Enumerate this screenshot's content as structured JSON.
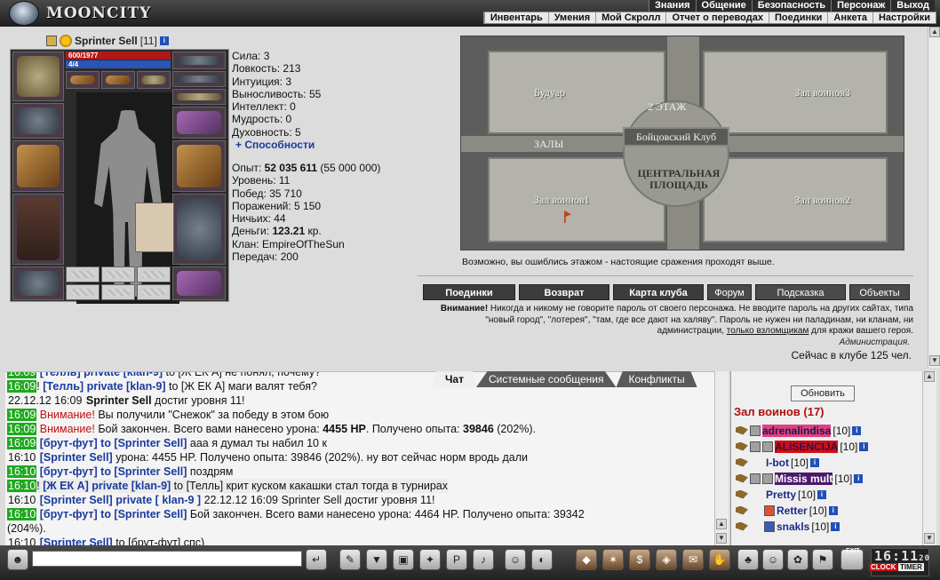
{
  "header": {
    "logo_text": "MOONCITY",
    "top_nav": [
      "Знания",
      "Общение",
      "Безопасность",
      "Персонаж",
      "Выход"
    ],
    "sub_nav": [
      "Инвентарь",
      "Умения",
      "Мой Скролл",
      "Отчет о переводах",
      "Поединки",
      "Анкета",
      "Настройки"
    ]
  },
  "character": {
    "name": "Sprinter Sell",
    "level_badge": "[11]",
    "hp": "600/1977",
    "mp": "4/4",
    "stats": {
      "strength": "Сила: 3",
      "agility": "Ловкость: 213",
      "intuition": "Интуиция: 3",
      "endurance": "Выносливость: 55",
      "intellect": "Интеллект: 0",
      "wisdom": "Мудрость: 0",
      "spirit": "Духовность: 5",
      "abilities_link": "+ Способности"
    },
    "exp_label": "Опыт: ",
    "exp_value": "52 035 611",
    "exp_next": " (55 000 000)",
    "level": "Уровень: 11",
    "wins": "Побед: 35 710",
    "losses": "Поражений: 5 150",
    "draws": "Ничьих: 44",
    "money_label": "Деньги: ",
    "money_value": "123.21",
    "money_unit": " кр.",
    "clan": "Клан: EmpireOfTheSun",
    "transfers": "Передач: 200"
  },
  "map": {
    "room_boudoir": "Будуар",
    "room_warriors3": "Зал воинов3",
    "room_warriors1": "Зал воинов1",
    "room_warriors2": "Зал воинов2",
    "floor_label": "2 ЭТАЖ",
    "club_label": "Бойцовский Клуб",
    "halls_label": "ЗАЛЫ",
    "square_label": "ЦЕНТРАЛЬНАЯ ПЛОЩАДЬ",
    "message": "Возможно, вы ошиблись этажом - настоящие сражения проходят выше."
  },
  "buttons": {
    "duels": "Поединки",
    "return": "Возврат",
    "club_map": "Карта клуба",
    "forum": "Форум",
    "hint": "Подсказка",
    "objects": "Объекты"
  },
  "warning": {
    "bold": "Внимание!",
    "text1": " Никогда и никому не говорите пароль от своего персонажа. Не вводите пароль на других сайтах, типа \"новый город\", \"лотерея\", \"там, где все дают на халяву\". Пароль не нужен ни паладинам, ни кланам, ни администрации, ",
    "underlined": "только взломщикам",
    "text2": " для кражи вашего героя.",
    "signature": "Администрация.",
    "online": "Сейчас в клубе 125 чел."
  },
  "chat_tabs": [
    "Чат",
    "Системные сообщения",
    "Конфликты"
  ],
  "chat": {
    "l0_ts": "16:09",
    "l0_a": "[Телль]",
    "l0_b": "private [klan-9]",
    "l0_c": " to [Ж ЕК А] не понял, почему?",
    "l1_ts": "16:09",
    "l1_a": "[Телль]",
    "l1_b": "private [klan-9]",
    "l1_c": " to [Ж ЕК А] маги валят тебя?",
    "l2_ts": "22.12.12 16:09",
    "l2_a": "Sprinter Sell",
    "l2_c": " достиг уровня 11!",
    "l3_ts": "16:09",
    "l3_a": "Внимание!",
    "l3_c": " Вы получили \"Снежок\" за победу в этом бою",
    "l4_ts": "16:09",
    "l4_a": "Внимание!",
    "l4_c1": " Бой закончен. Всего вами нанесено урона: ",
    "l4_hp": "4455 HP",
    "l4_c2": ". Получено опыта: ",
    "l4_exp": "39846",
    "l4_c3": " (202%).",
    "l5_ts": "16:09",
    "l5_a": "[брут-фут]",
    "l5_b": "to [Sprinter Sell]",
    "l5_c": " ааа я думал ты набил 10 к",
    "l6_ts": "16:10",
    "l6_a": "[Sprinter Sell]",
    "l6_c": " урона: 4455 HP. Получено опыта: 39846 (202%). ну вот сейчас норм вродь дали",
    "l7_ts": "16:10",
    "l7_a": "[брут-фут]",
    "l7_b": "to [Sprinter Sell]",
    "l7_c": " поздрям",
    "l8_ts": "16:10",
    "l8_a": "[Ж ЕК А]",
    "l8_b": "private [klan-9]",
    "l8_c": " to [Телль] крит куском какашки стал тогда в турнирах",
    "l9_ts": "16:10",
    "l9_a": "[Sprinter Sell]",
    "l9_b": "private [ klan-9 ]",
    "l9_c": " 22.12.12 16:09 Sprinter Sell достиг уровня 11!",
    "l10_ts": "16:10",
    "l10_a": "[брут-фут]",
    "l10_b": "to [Sprinter Sell]",
    "l10_c": " Бой закончен. Всего вами нанесено урона: 4464 HP. Получено опыта: 39342",
    "l10_cont": "(204%).",
    "l11_ts": "16:10",
    "l11_a": "[Sprinter Sell]",
    "l11_c": " to [брут-фут] спс)"
  },
  "room_panel": {
    "refresh": "Обновить",
    "title": "Зал воинов (17)",
    "players": [
      {
        "name": "adrenalindisa",
        "level": "[10]"
      },
      {
        "name": "ALISENCIJA",
        "level": "[10]"
      },
      {
        "name": "I-bot",
        "level": "[10]"
      },
      {
        "name": "Missis mult",
        "level": "[10]"
      },
      {
        "name": "Pretty",
        "level": "[10]"
      },
      {
        "name": "Retter",
        "level": "[10]"
      },
      {
        "name": "snakls",
        "level": "[10]"
      }
    ]
  },
  "clock": {
    "time": "16:11",
    "seconds": "20",
    "label_clock": "CLOCK",
    "label_timer": "TIMER",
    "exit": "EXIT"
  }
}
